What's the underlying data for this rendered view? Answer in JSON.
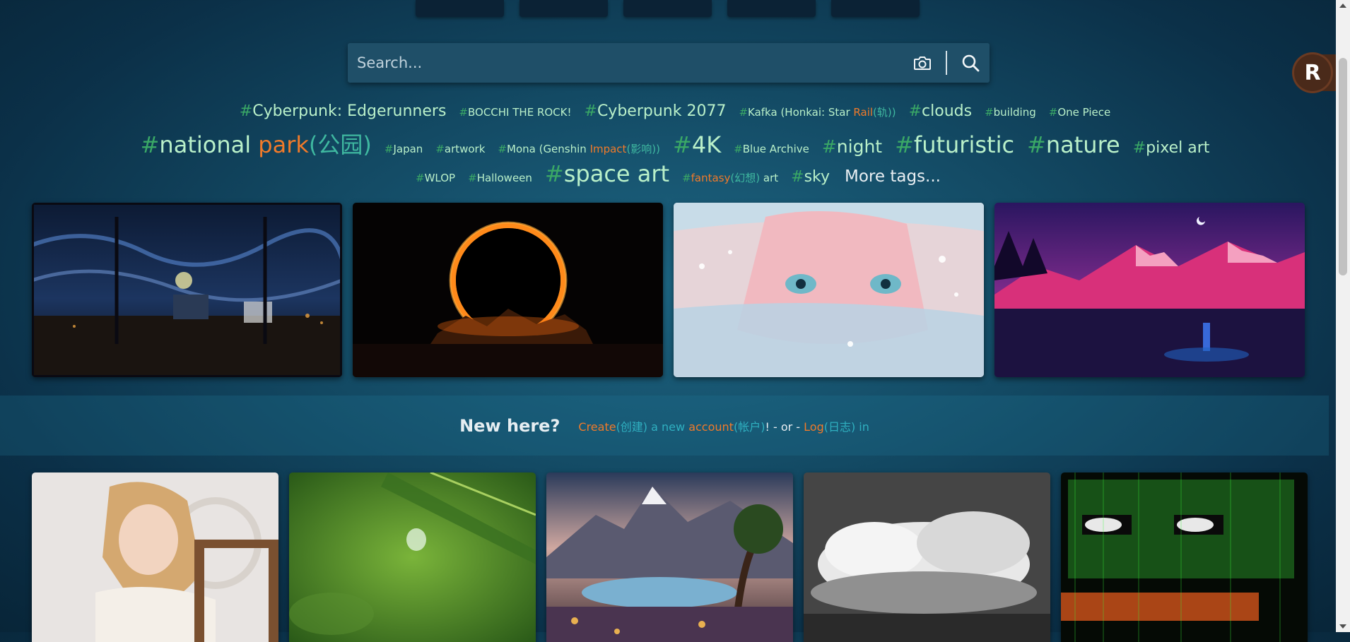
{
  "search": {
    "placeholder": "Search..."
  },
  "tags_row1": [
    {
      "label": "Cyberpunk: Edgerunners",
      "size": "s3"
    },
    {
      "label": "BOCCHI THE ROCK!",
      "size": "s1"
    },
    {
      "label": "Cyberpunk 2077",
      "size": "s3"
    },
    {
      "label_parts": [
        "Kafka (Honkai: Star ",
        "Rail",
        "(轨))"
      ],
      "size": "s1"
    },
    {
      "label": "clouds",
      "size": "s3"
    },
    {
      "label": "building",
      "size": "s1"
    },
    {
      "label": "One Piece",
      "size": "s1"
    }
  ],
  "tags_row2": [
    {
      "label_parts": [
        "national ",
        "park",
        "(公园)"
      ],
      "size": "s5"
    },
    {
      "label": "Japan",
      "size": "s1"
    },
    {
      "label": "artwork",
      "size": "s1"
    },
    {
      "label_parts": [
        "Mona (Genshin ",
        "Impact",
        "(影响))"
      ],
      "size": "s1"
    },
    {
      "label": "4K",
      "size": "s5"
    },
    {
      "label": "Blue Archive",
      "size": "s1"
    },
    {
      "label": "night",
      "size": "s4"
    },
    {
      "label": "futuristic",
      "size": "s5"
    },
    {
      "label": "nature",
      "size": "s5"
    },
    {
      "label": "pixel art",
      "size": "s3"
    }
  ],
  "tags_row3": [
    {
      "label": "WLOP",
      "size": "s1"
    },
    {
      "label": "Halloween",
      "size": "s1"
    },
    {
      "label": "space art",
      "size": "s5"
    },
    {
      "label_parts": [
        "fantasy",
        "(幻想)",
        " art"
      ],
      "size": "s1"
    },
    {
      "label": "sky",
      "size": "s3"
    }
  ],
  "more_tags": "More tags...",
  "t1_l": "Cyberpunk: Edgerunners",
  "t1_b": "BOCCHI THE ROCK!",
  "t1_c": "Cyberpunk 2077",
  "t1_k1": "Kafka (Honkai: Star ",
  "t1_k2": "Rail",
  "t1_k3": "(轨))",
  "t1_cl": "clouds",
  "t1_bu": "building",
  "t1_op": "One Piece",
  "t2_n1": "national ",
  "t2_n2": "park",
  "t2_n3": "(公园)",
  "t2_ja": "Japan",
  "t2_ar": "artwork",
  "t2_m1": "Mona (Genshin ",
  "t2_m2": "Impact",
  "t2_m3": "(影响))",
  "t2_4k": "4K",
  "t2_ba": "Blue Archive",
  "t2_ni": "night",
  "t2_fu": "futuristic",
  "t2_na": "nature",
  "t2_px": "pixel art",
  "t3_wl": "WLOP",
  "t3_ha": "Halloween",
  "t3_sp": "space art",
  "t3_f1": "fantasy",
  "t3_f2": "(幻想)",
  "t3_f3": " art",
  "t3_sk": "sky",
  "new_here": {
    "title": "New here?",
    "create": "Create",
    "create_cn": "(创建)",
    "a_new": " a new ",
    "account": "account",
    "account_cn": "(帐户)",
    "bang": "!",
    "or": " - or - ",
    "log": "Log",
    "log_cn": "(日志)",
    "in": " in"
  },
  "avatar_letter": "R",
  "colors": {
    "background": "#134a64",
    "search_bg": "#1f4f68",
    "tag_green": "#b9f0c9",
    "accent_orange": "#f07a2a",
    "accent_teal": "#2fb0c0"
  }
}
